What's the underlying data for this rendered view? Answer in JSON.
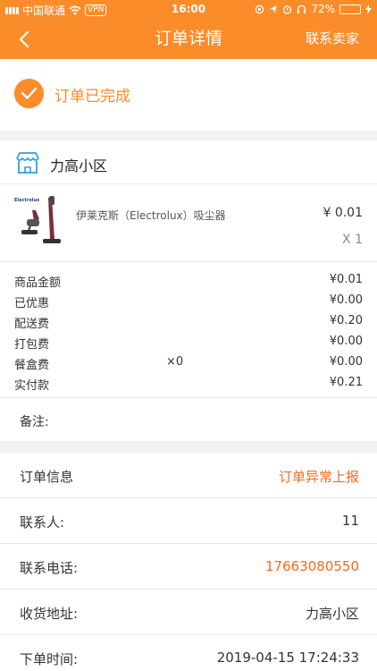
{
  "statusbar": {
    "carrier": "中国联通",
    "vpn": "VPN",
    "time": "16:00",
    "battery": "72%",
    "battery_level": 0.72
  },
  "navbar": {
    "title": "订单详情",
    "contact_label": "联系卖家"
  },
  "order_status": {
    "text": "订单已完成"
  },
  "store": {
    "name": "力高小区"
  },
  "product": {
    "brand_logo_text": "Electrolux",
    "name": "伊莱克斯（Electrolux）吸尘器",
    "price": "¥ 0.01",
    "quantity": "X 1"
  },
  "fees": [
    {
      "label": "商品金额",
      "mid": "",
      "value": "¥0.01"
    },
    {
      "label": "已优惠",
      "mid": "",
      "value": "¥0.00"
    },
    {
      "label": "配送费",
      "mid": "",
      "value": "¥0.20"
    },
    {
      "label": "打包费",
      "mid": "",
      "value": "¥0.00"
    },
    {
      "label": "餐盒费",
      "mid": "×0",
      "value": "¥0.00"
    },
    {
      "label": "实付款",
      "mid": "",
      "value": "¥0.21"
    }
  ],
  "remark": {
    "label": "备注:"
  },
  "order_info": {
    "header_label": "订单信息",
    "report_label": "订单异常上报",
    "contact_person_label": "联系人:",
    "contact_person_value": "11",
    "phone_label": "联系电话:",
    "phone_value": "17663080550",
    "address_label": "收货地址:",
    "address_value": "力高小区",
    "time_label": "下单时间:",
    "time_value": "2019-04-15 17:24:33"
  },
  "colors": {
    "accent": "#fa8c2a",
    "link": "#f56a1e",
    "shop_icon": "#2aa0e6"
  }
}
